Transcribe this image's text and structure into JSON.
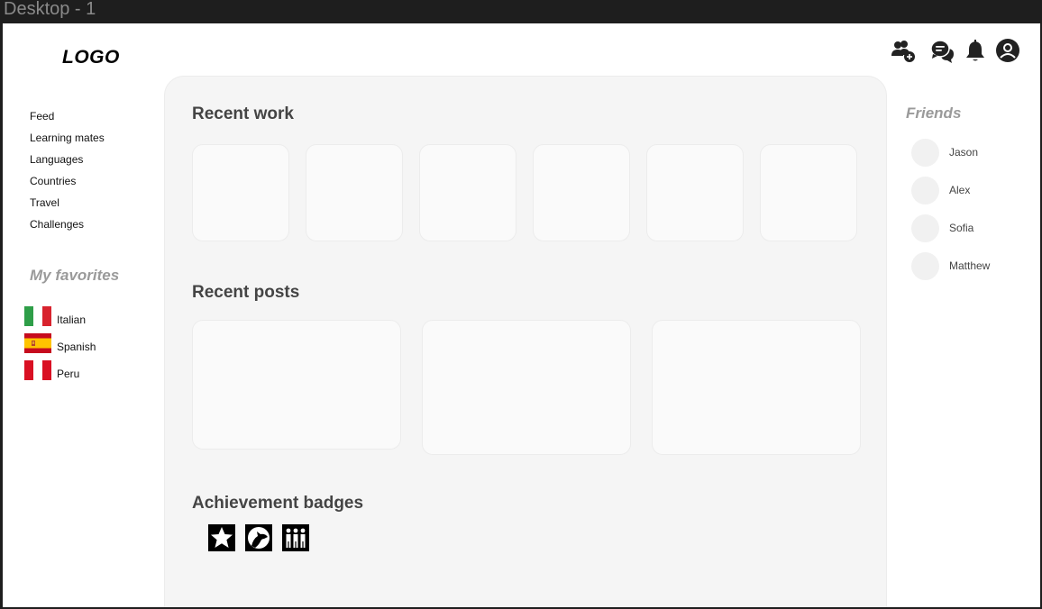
{
  "frame": {
    "title": "Desktop - 1"
  },
  "header": {
    "logo": "LOGO",
    "icons": [
      "add-friend-icon",
      "chat-icon",
      "bell-icon",
      "profile-icon"
    ]
  },
  "nav": {
    "items": [
      {
        "label": "Feed"
      },
      {
        "label": "Learning mates"
      },
      {
        "label": "Languages"
      },
      {
        "label": "Countries"
      },
      {
        "label": "Travel"
      },
      {
        "label": "Challenges"
      }
    ]
  },
  "favorites": {
    "title": "My favorites",
    "items": [
      {
        "label": "Italian",
        "flag": "italy-flag-icon"
      },
      {
        "label": "Spanish",
        "flag": "spain-flag-icon"
      },
      {
        "label": "Peru",
        "flag": "peru-flag-icon"
      }
    ]
  },
  "main": {
    "recent_work": {
      "title": "Recent work"
    },
    "recent_posts": {
      "title": "Recent posts"
    },
    "badges": {
      "title": "Achievement badges",
      "items": [
        "star-badge-icon",
        "wolf-badge-icon",
        "group-badge-icon"
      ]
    }
  },
  "friends": {
    "title": "Friends",
    "items": [
      {
        "name": "Jason"
      },
      {
        "name": "Alex"
      },
      {
        "name": "Sofia"
      },
      {
        "name": "Matthew"
      }
    ]
  },
  "colors": {
    "background": "#ffffff",
    "panel": "#f5f5f5",
    "card": "#fafafa",
    "muted_title": "#9a9a9a",
    "heading": "#444444"
  }
}
